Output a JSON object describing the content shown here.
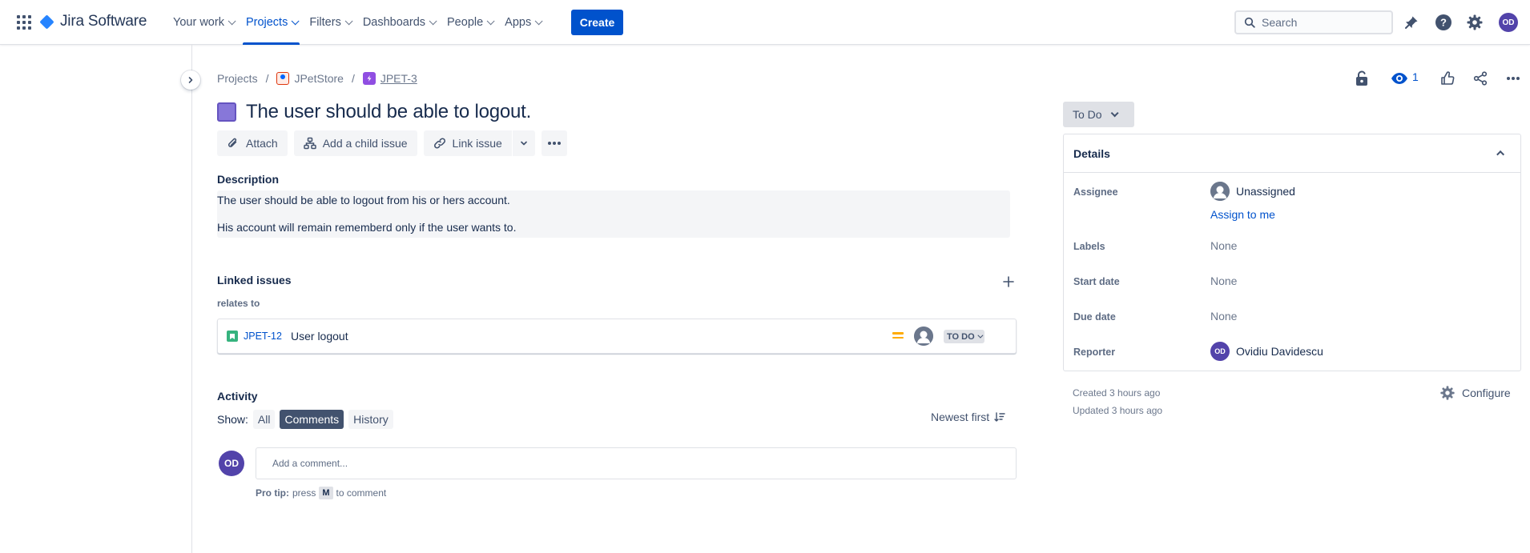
{
  "topnav": {
    "product_name": "Jira Software",
    "items": [
      {
        "label": "Your work"
      },
      {
        "label": "Projects"
      },
      {
        "label": "Filters"
      },
      {
        "label": "Dashboards"
      },
      {
        "label": "People"
      },
      {
        "label": "Apps"
      }
    ],
    "create_label": "Create",
    "search_placeholder": "Search",
    "user_initials": "OD",
    "brand_color": "#0052cc"
  },
  "breadcrumb": {
    "root": "Projects",
    "project": "JPetStore",
    "issue_key": "JPET-3"
  },
  "issue": {
    "title": "The user should be able to logout.",
    "toolbar": {
      "attach": "Attach",
      "add_child": "Add a child issue",
      "link_issue": "Link issue"
    },
    "description_label": "Description",
    "description_lines": [
      "The user should be able to logout from his or hers account.",
      "His account will remain rememberd only if the user wants to."
    ]
  },
  "linked_issues": {
    "heading": "Linked issues",
    "relation": "relates to",
    "items": [
      {
        "key": "JPET-12",
        "summary": "User logout",
        "status": "TO DO",
        "priority_icon": "medium-priority-icon"
      }
    ]
  },
  "activity": {
    "heading": "Activity",
    "show_label": "Show:",
    "filters": [
      "All",
      "Comments",
      "History"
    ],
    "active_filter": "Comments",
    "sort_label": "Newest first",
    "commenter_initials": "OD",
    "comment_placeholder": "Add a comment...",
    "pro_tip_label": "Pro tip:",
    "pro_tip_press": "press",
    "pro_tip_key": "M",
    "pro_tip_suffix": "to comment"
  },
  "sidebar_right": {
    "watch_count": "1",
    "status": "To Do",
    "details_heading": "Details",
    "fields": {
      "assignee_label": "Assignee",
      "assignee_value": "Unassigned",
      "assign_to_me": "Assign to me",
      "labels_label": "Labels",
      "labels_value": "None",
      "start_date_label": "Start date",
      "start_date_value": "None",
      "due_date_label": "Due date",
      "due_date_value": "None",
      "reporter_label": "Reporter",
      "reporter_value": "Ovidiu Davidescu",
      "reporter_initials": "OD"
    },
    "created": "Created 3 hours ago",
    "updated": "Updated 3 hours ago",
    "configure_label": "Configure"
  }
}
